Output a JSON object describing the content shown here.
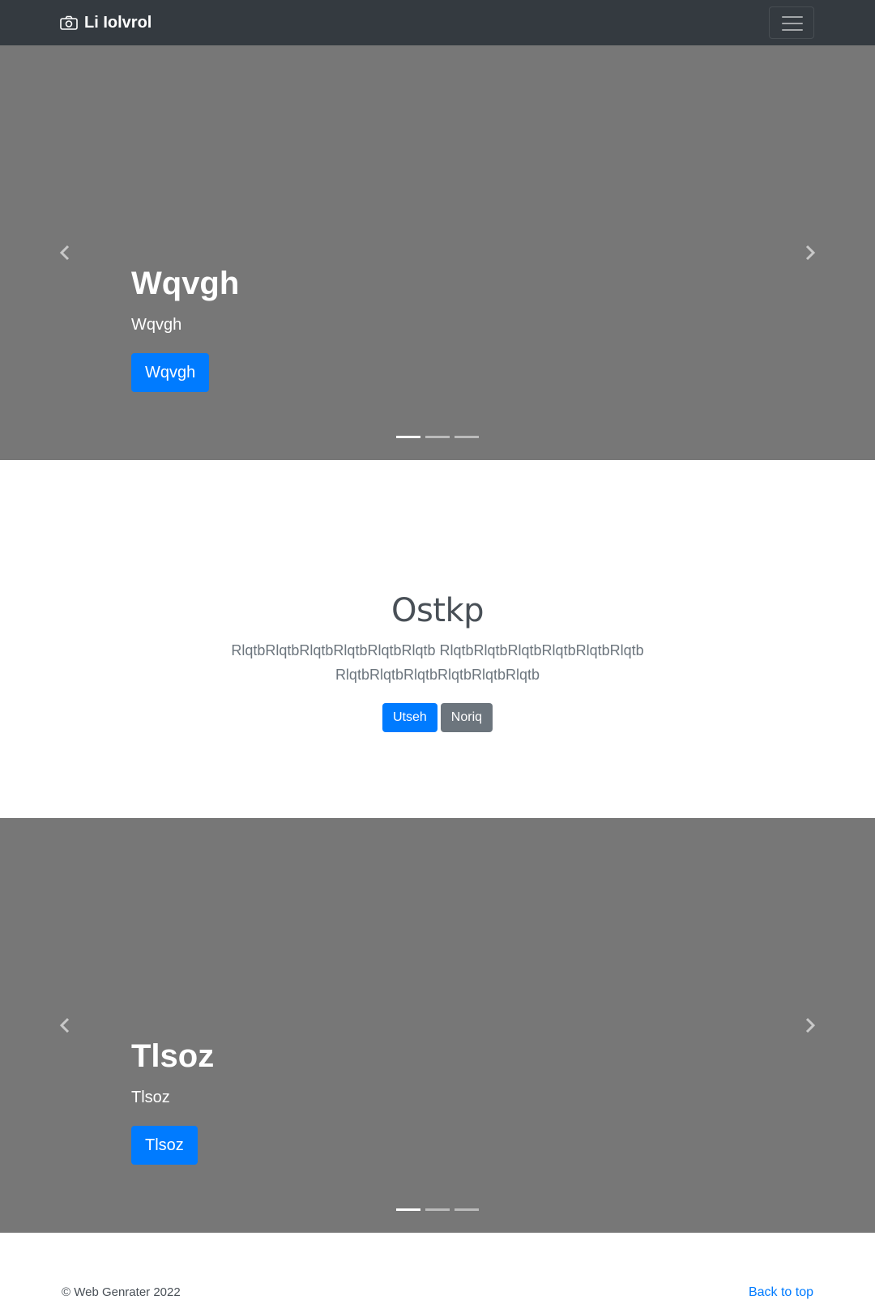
{
  "navbar": {
    "brand": "Li Iolvrol",
    "brand_icon": "camera-icon",
    "toggler_icon": "hamburger-icon"
  },
  "carousel_1": {
    "title": "Wqvgh",
    "subtitle": "Wqvgh",
    "button": "Wqvgh",
    "indicators": 3,
    "active_indicator": 0
  },
  "jumbotron": {
    "heading": "Ostkp",
    "lead": "RlqtbRlqtbRlqtbRlqtbRlqtbRlqtb RlqtbRlqtbRlqtbRlqtbRlqtbRlqtb RlqtbRlqtbRlqtbRlqtbRlqtbRlqtb",
    "primary_button": "Utseh",
    "secondary_button": "Noriq"
  },
  "carousel_2": {
    "title": "Tlsoz",
    "subtitle": "Tlsoz",
    "button": "Tlsoz",
    "indicators": 3,
    "active_indicator": 0
  },
  "footer": {
    "copyright": "© Web Genrater 2022",
    "back_to_top": "Back to top"
  },
  "colors": {
    "navbar_bg": "#343a40",
    "carousel_bg": "#777777",
    "primary": "#007bff",
    "secondary": "#6c757d"
  }
}
